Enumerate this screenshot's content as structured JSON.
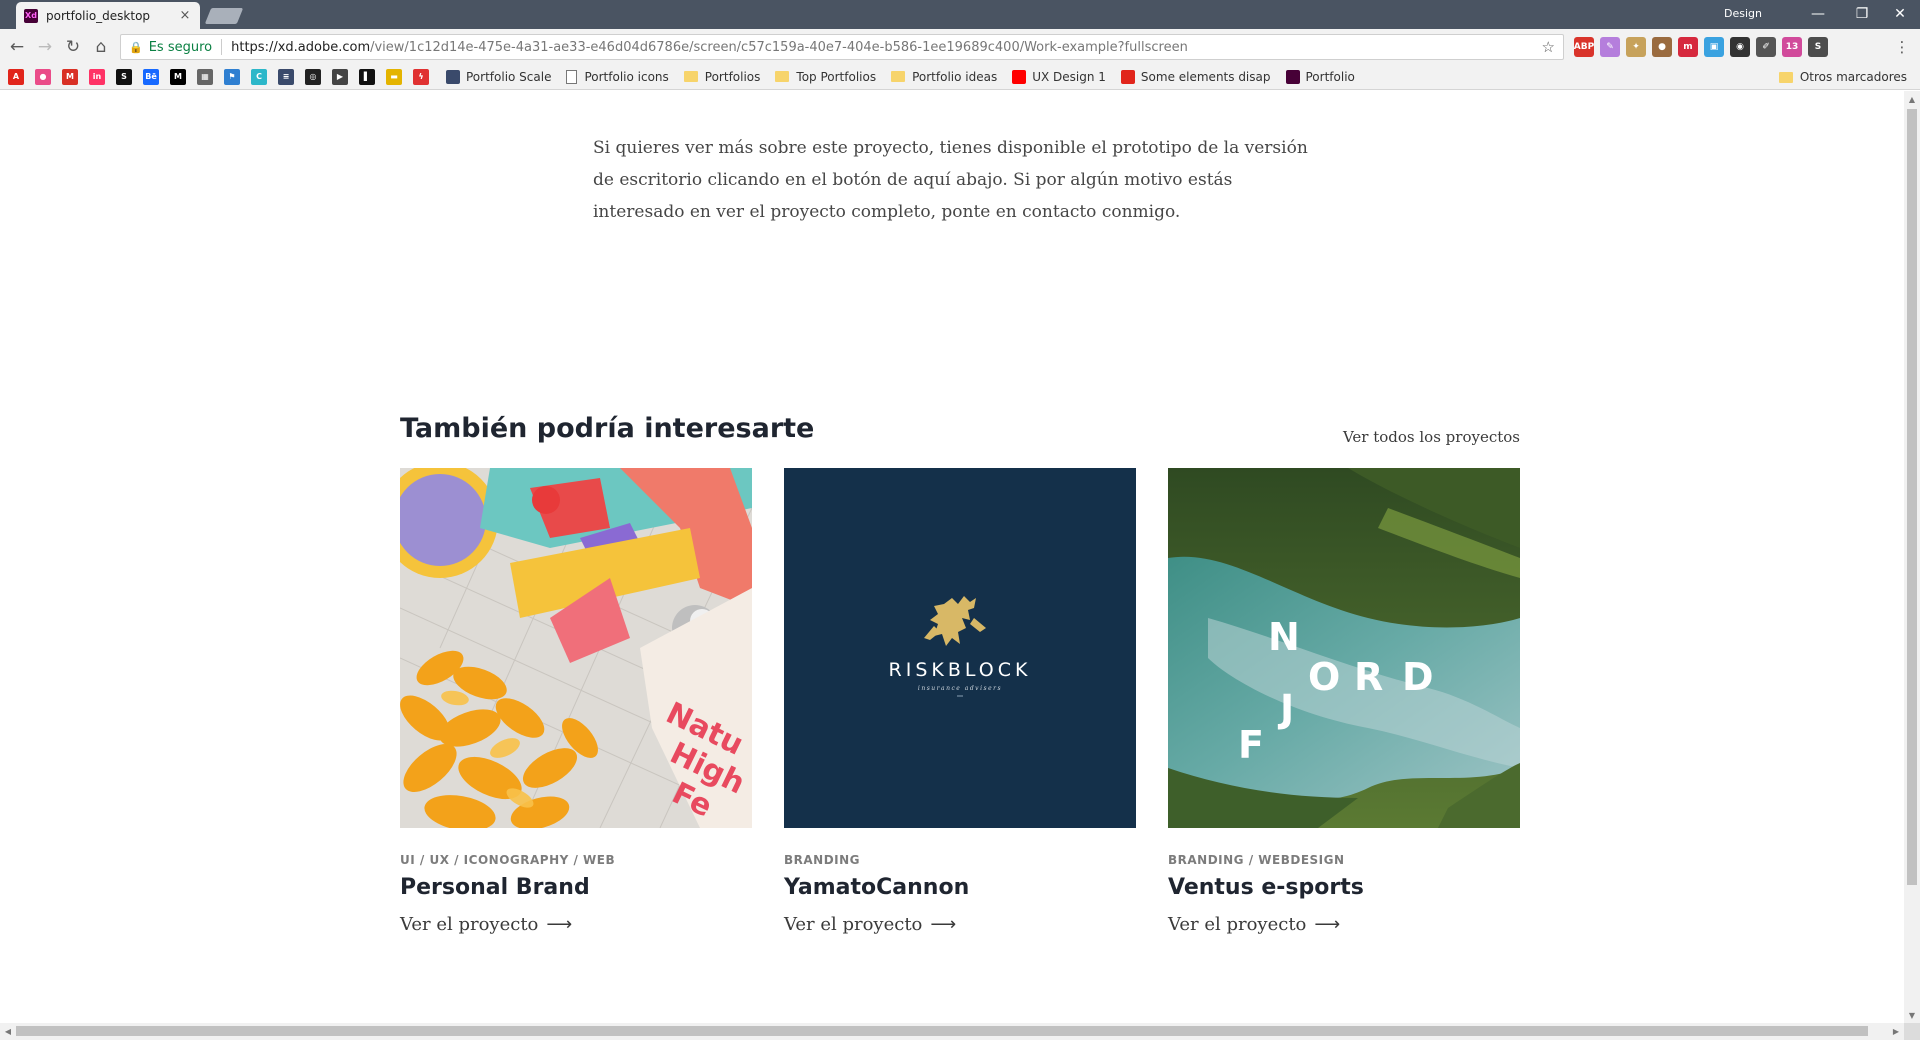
{
  "browser": {
    "tab_title": "portfolio_desktop",
    "tab_favicon": "Xd",
    "tab_close": "×",
    "profile_name": "Design",
    "secure_label": "Es seguro",
    "url_host": "https://xd.adobe.com",
    "url_path": "/view/1c12d14e-475e-4a31-ae33-e46d04d6786e/screen/c57c159a-40e7-404e-b586-1ee19689c400/Work-example?fullscreen",
    "window_controls": {
      "minimize": "—",
      "maximize": "❐",
      "close": "✕"
    },
    "nav_icons": {
      "back": "←",
      "forward": "→",
      "reload": "↻",
      "home": "⌂"
    },
    "star_icon": "☆",
    "menu_icon": "⋮",
    "extensions": [
      {
        "name": "adblock-icon",
        "label": "ABP",
        "color": "#d9342b"
      },
      {
        "name": "pen-extension-icon",
        "label": "✎",
        "color": "#b57edc"
      },
      {
        "name": "dropper-extension-icon",
        "label": "✦",
        "color": "#c7a25b"
      },
      {
        "name": "cookie-extension-icon",
        "label": "●",
        "color": "#9a6b3f"
      },
      {
        "name": "m-extension-icon",
        "label": "m",
        "color": "#d6293e"
      },
      {
        "name": "window-extension-icon",
        "label": "▣",
        "color": "#3aa2e0"
      },
      {
        "name": "camera-extension-icon",
        "label": "◉",
        "color": "#333333"
      },
      {
        "name": "colorpick-extension-icon",
        "label": "✐",
        "color": "#555555"
      },
      {
        "name": "notify-extension-icon",
        "label": "13",
        "color": "#d14a9b"
      },
      {
        "name": "s-extension-icon",
        "label": "S",
        "color": "#4d4d4d"
      }
    ],
    "bookmark_icons": [
      {
        "name": "adobe-bookmark-icon",
        "label": "A",
        "color": "#e1251b"
      },
      {
        "name": "dribbble-bookmark-icon",
        "label": "●",
        "color": "#ea4c89"
      },
      {
        "name": "gmail-bookmark-icon",
        "label": "M",
        "color": "#d93025"
      },
      {
        "name": "invision-bookmark-icon",
        "label": "in",
        "color": "#ff3366"
      },
      {
        "name": "s-bookmark-icon",
        "label": "S",
        "color": "#111111"
      },
      {
        "name": "behance-bookmark-icon",
        "label": "Bē",
        "color": "#1769ff"
      },
      {
        "name": "medium-bookmark-icon",
        "label": "M",
        "color": "#000000"
      },
      {
        "name": "grid-bookmark-icon",
        "label": "▦",
        "color": "#666666"
      },
      {
        "name": "flag-bookmark-icon",
        "label": "⚑",
        "color": "#2f7fd1"
      },
      {
        "name": "c-bookmark-icon",
        "label": "C",
        "color": "#2cb7c9"
      },
      {
        "name": "lines-bookmark-icon",
        "label": "≡",
        "color": "#3a4a6b"
      },
      {
        "name": "circle-bookmark-icon",
        "label": "◎",
        "color": "#222222"
      },
      {
        "name": "play-bookmark-icon",
        "label": "▶",
        "color": "#444444"
      },
      {
        "name": "bar-bookmark-icon",
        "label": "▌",
        "color": "#111111"
      },
      {
        "name": "stripes-bookmark-icon",
        "label": "▬",
        "color": "#e4b400"
      },
      {
        "name": "bolt-bookmark-icon",
        "label": "ϟ",
        "color": "#e03131"
      }
    ],
    "bookmarks": [
      {
        "label": "Portfolio Scale",
        "icon": "lines-icon",
        "kind": "site",
        "color": "#3a4a6b"
      },
      {
        "label": "Portfolio icons",
        "icon": "page-icon",
        "kind": "page",
        "color": ""
      },
      {
        "label": "Portfolios",
        "icon": "folder-icon",
        "kind": "folder",
        "color": ""
      },
      {
        "label": "Top Portfolios",
        "icon": "folder-icon",
        "kind": "folder",
        "color": ""
      },
      {
        "label": "Portfolio ideas",
        "icon": "folder-icon",
        "kind": "folder",
        "color": ""
      },
      {
        "label": "UX Design 1",
        "icon": "youtube-icon",
        "kind": "site",
        "color": "#ff0000"
      },
      {
        "label": "Some elements disap",
        "icon": "adobe-icon",
        "kind": "site",
        "color": "#e1251b"
      },
      {
        "label": "Portfolio",
        "icon": "xd-icon",
        "kind": "site",
        "color": "#470137"
      }
    ],
    "other_bookmarks": "Otros marcadores"
  },
  "page": {
    "intro_text": "Si quieres ver más sobre este proyecto, tienes disponible el prototipo de la versión de escritorio clicando en el botón de aquí abajo. Si por algún motivo estás interesado en ver el proyecto completo, ponte en contacto conmigo.",
    "section_title": "También podría interesarte",
    "view_all_label": "Ver todos los proyectos",
    "link_arrow": "⟶",
    "cards": [
      {
        "tags": "UI / UX / ICONOGRAPHY / WEB",
        "title": "Personal Brand",
        "link": "Ver el proyecto",
        "image_text": "Natu High Fe"
      },
      {
        "tags": "BRANDING",
        "title": "YamatoCannon",
        "link": "Ver el proyecto",
        "image_text": "RISKBLOCK",
        "image_subtext": "insurance advisers"
      },
      {
        "tags": "BRANDING / WEBDESIGN",
        "title": "Ventus e-sports",
        "link": "Ver el proyecto",
        "image_letters": [
          "N",
          "O",
          "R",
          "D",
          "J",
          "F"
        ]
      }
    ]
  },
  "colors": {
    "tabstrip": "#4a5462",
    "riskblock_bg": "#14304a",
    "riskblock_gold": "#d8b866",
    "heading": "#1f2530"
  }
}
